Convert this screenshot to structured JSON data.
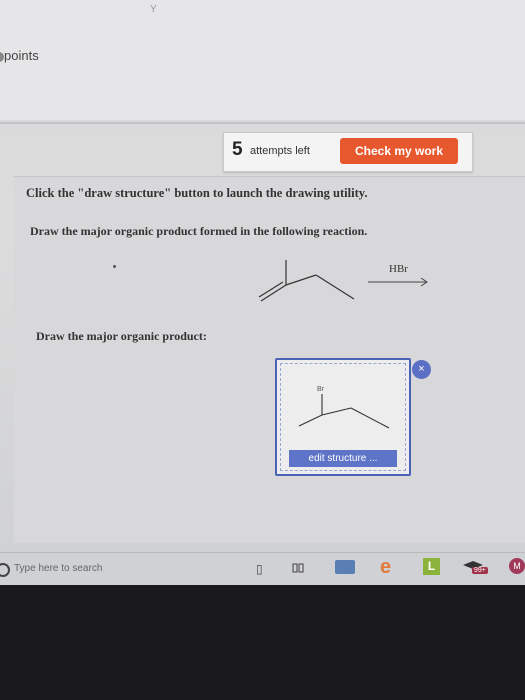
{
  "header": {
    "points_label": "points"
  },
  "attempts": {
    "count": "5",
    "label": "attempts left"
  },
  "check_button": {
    "label": "Check my work"
  },
  "instructions": {
    "line1": "Click the \"draw structure\" button to launch the drawing utility.",
    "line2": "Draw the major organic product formed in the following reaction.",
    "line3": "Draw the major organic product:"
  },
  "reaction": {
    "reagent": "HBr",
    "product_atom_label": "Br"
  },
  "editor": {
    "edit_label": "edit structure ...",
    "close_icon": "close-icon",
    "close_symbol": "×"
  },
  "taskbar": {
    "search_placeholder": "Type here to search",
    "L_label": "L",
    "badge": "99+",
    "M_label": "M"
  },
  "colors": {
    "accent": "#e8582f",
    "editor_border": "#4a63b8",
    "edit_button": "#5d74c8"
  }
}
